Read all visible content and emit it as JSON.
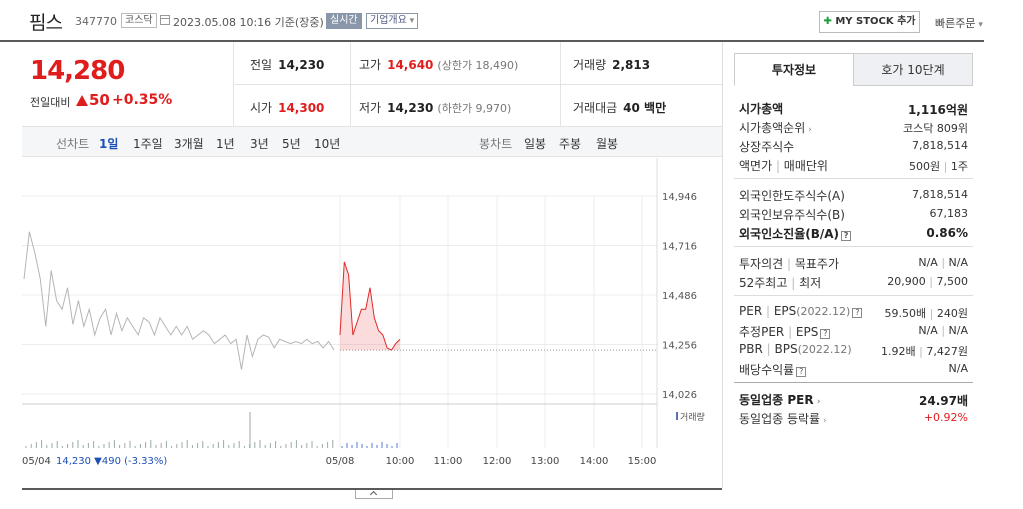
{
  "header": {
    "name": "핌스",
    "code": "347770",
    "market": "코스닥",
    "datetime": "2023.05.08 10:16 기준(장중)",
    "realtime": "실시간",
    "corp_info": "기업개요",
    "mystock": "MY STOCK 추가",
    "fast_order": "빠른주문"
  },
  "price": {
    "current": "14,280",
    "compare_label": "전일대비",
    "change": "50",
    "rate": "+0.35%"
  },
  "summary": {
    "prev_label": "전일",
    "prev": "14,230",
    "high_label": "고가",
    "high": "14,640",
    "upper_limit": "(상한가 18,490)",
    "volume_label": "거래량",
    "volume": "2,813",
    "open_label": "시가",
    "open": "14,300",
    "low_label": "저가",
    "low": "14,230",
    "lower_limit": "(하한가 9,970)",
    "amount_label": "거래대금",
    "amount": "40 백만"
  },
  "tabs": {
    "line_label": "선차트",
    "periods": [
      "1일",
      "1주일",
      "3개월",
      "1년",
      "3년",
      "5년",
      "10년"
    ],
    "active": "1일",
    "candle_label": "봉차트",
    "candles": [
      "일봉",
      "주봉",
      "월봉"
    ]
  },
  "chart_data": {
    "type": "line",
    "y_ticks": [
      "14,946",
      "14,716",
      "14,486",
      "14,256",
      "14,026"
    ],
    "ylim": [
      14026,
      14946
    ],
    "x_ticks": [
      "05/04",
      "05/08",
      "10:00",
      "11:00",
      "12:00",
      "13:00",
      "14:00",
      "15:00"
    ],
    "volume_label": "거래량",
    "prev_close": 14230,
    "series": [
      {
        "name": "05/04",
        "values": [
          14560,
          14780,
          14680,
          14560,
          14340,
          14600,
          14460,
          14420,
          14520,
          14350,
          14460,
          14340,
          14420,
          14300,
          14380,
          14420,
          14300,
          14400,
          14320,
          14380,
          14340,
          14300,
          14380,
          14360,
          14300,
          14380,
          14340,
          14300,
          14340,
          14300,
          14340,
          14280,
          14300,
          14320,
          14300,
          14260,
          14280,
          14300,
          14260,
          14280,
          14140,
          14300,
          14200,
          14280,
          14300,
          14290,
          14240,
          14280,
          14270,
          14260,
          14270,
          14260,
          14280,
          14260,
          14270,
          14240,
          14270,
          14230
        ]
      },
      {
        "name": "05/08",
        "values": [
          14300,
          14640,
          14580,
          14300,
          14360,
          14420,
          14420,
          14520,
          14380,
          14320,
          14300,
          14240,
          14230,
          14260,
          14280
        ]
      }
    ],
    "footer_date": "05/04",
    "footer_price": "14,230",
    "footer_change": "▼490",
    "footer_rate": "(-3.33%)"
  },
  "invest": {
    "tabs": [
      "투자정보",
      "호가 10단계"
    ],
    "rows1": [
      {
        "k": "시가총액",
        "v": "1,116억원",
        "bold": true
      },
      {
        "k": "시가총액순위",
        "v": "코스닥 809위"
      },
      {
        "k": "상장주식수",
        "v": "7,818,514"
      },
      {
        "k": "액면가",
        "k2": "매매단위",
        "v": "500원",
        "v2": "1주"
      }
    ],
    "rows2": [
      {
        "k": "외국인한도주식수(A)",
        "v": "7,818,514"
      },
      {
        "k": "외국인보유주식수(B)",
        "v": "67,183"
      },
      {
        "k": "외국인소진율(B/A)",
        "v": "0.86%",
        "bold": true
      }
    ],
    "rows3": [
      {
        "k": "투자의견",
        "k2": "목표주가",
        "v": "N/A",
        "v2": "N/A"
      },
      {
        "k": "52주최고",
        "k2": "최저",
        "v": "20,900",
        "v2": "7,500"
      }
    ],
    "rows4": [
      {
        "k": "PER",
        "k2": "EPS",
        "k3": "(2022.12)",
        "v": "59.50배",
        "v2": "240원"
      },
      {
        "k": "추정PER",
        "k2": "EPS",
        "v": "N/A",
        "v2": "N/A"
      },
      {
        "k": "PBR",
        "k2": "BPS",
        "k3": "(2022.12)",
        "v": "1.92배",
        "v2": "7,427원"
      },
      {
        "k": "배당수익률",
        "v": "N/A"
      }
    ],
    "rows5": [
      {
        "k": "동일업종 PER",
        "v": "24.97배",
        "bold": true
      },
      {
        "k": "동일업종 등락률",
        "v": "+0.92%"
      }
    ]
  }
}
